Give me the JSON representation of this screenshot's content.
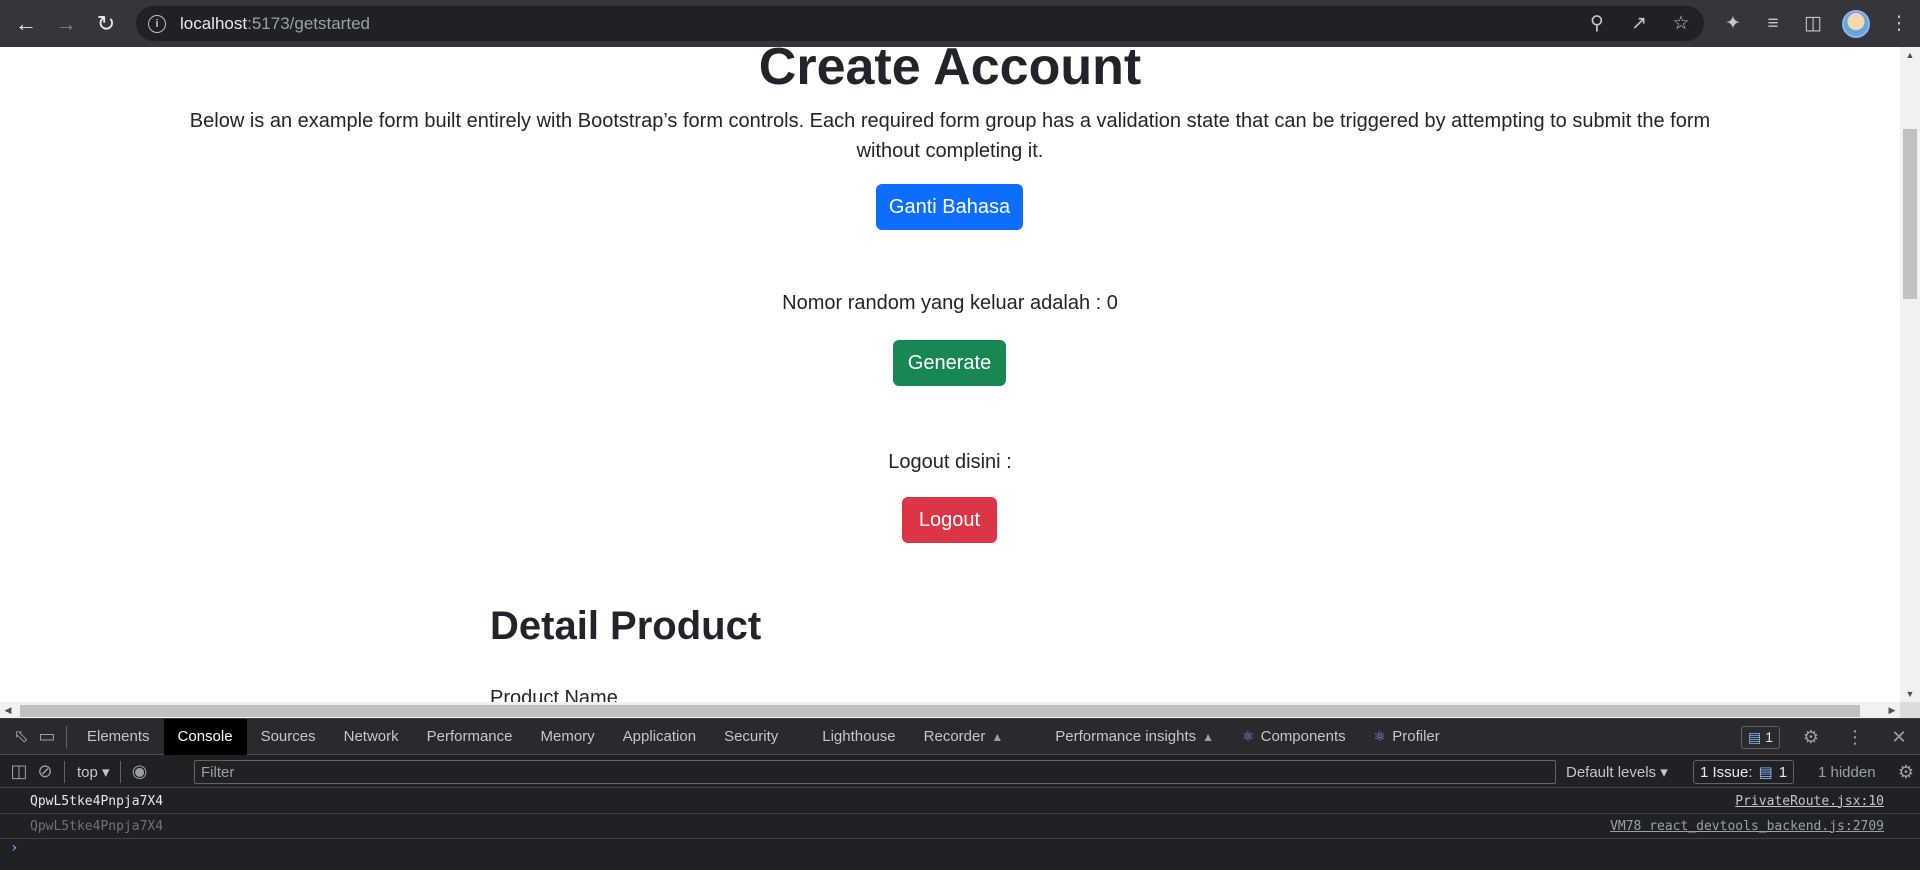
{
  "browser": {
    "url_host": "localhost",
    "url_path": ":5173/getstarted"
  },
  "page": {
    "title": "Create Account",
    "lead": "Below is an example form built entirely with Bootstrap’s form controls. Each required form group has a validation state that can be triggered by attempting to submit the form without completing it.",
    "language_button": "Ganti Bahasa",
    "random_text": "Nomor random yang keluar adalah : 0",
    "generate_button": "Generate",
    "logout_text": "Logout disini :",
    "logout_button": "Logout",
    "detail_heading": "Detail Product",
    "product_name_label": "Product Name"
  },
  "devtools": {
    "tabs": [
      "Elements",
      "Console",
      "Sources",
      "Network",
      "Performance",
      "Memory",
      "Application",
      "Security",
      "Lighthouse",
      "Recorder",
      "Performance insights",
      "Components",
      "Profiler"
    ],
    "active_tab": "Console",
    "message_badge_count": "1",
    "context": "top",
    "filter_placeholder": "Filter",
    "levels": "Default levels",
    "issues_label": "1 Issue:",
    "issues_count": "1",
    "hidden_label": "1 hidden",
    "logs": [
      {
        "message": "QpwL5tke4Pnpja7X4",
        "source": "PrivateRoute.jsx:10"
      },
      {
        "message": "QpwL5tke4Pnpja7X4",
        "source": "VM78 react_devtools_backend.js:2709"
      }
    ],
    "prompt": "›"
  }
}
